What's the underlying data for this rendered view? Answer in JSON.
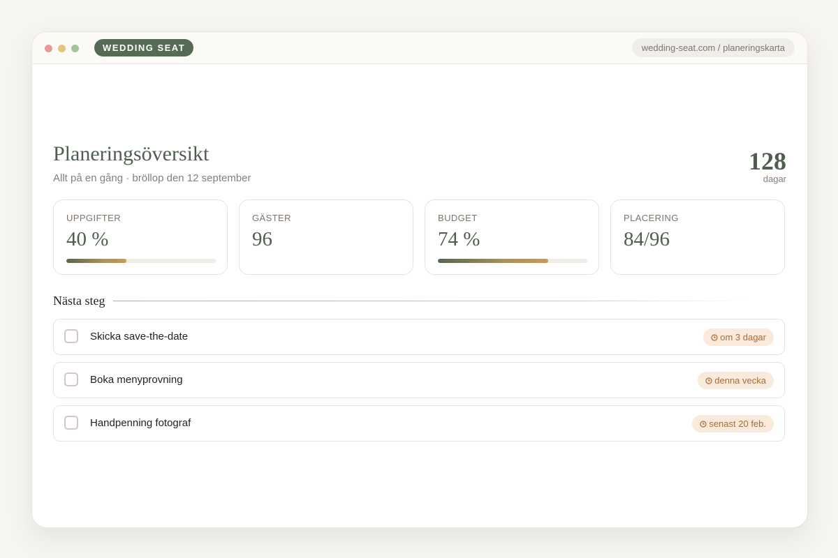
{
  "colors": {
    "brand": "#556b54",
    "dot_red": "#e8999b",
    "dot_yellow": "#e7c380",
    "dot_green": "#a5c49b",
    "accent_gold": "#c79a52",
    "badge_bg": "#f9eadb",
    "badge_text": "#a76c33"
  },
  "window": {
    "brand": "WEDDING SEAT",
    "url": "wedding-seat.com / planeringskarta"
  },
  "header": {
    "title": "Planeringsöversikt",
    "subtitle": "Allt på en gång · bröllop den 12 september",
    "countdown_value": "128",
    "countdown_unit": "dagar"
  },
  "stats": [
    {
      "label": "UPPGIFTER",
      "value": "40 %",
      "progress": 0.4
    },
    {
      "label": "GÄSTER",
      "value": "96"
    },
    {
      "label": "BUDGET",
      "value": "74 %",
      "progress": 0.74
    },
    {
      "label": "PLACERING",
      "value": "84/96"
    }
  ],
  "next_steps": {
    "title": "Nästa steg",
    "tasks": [
      {
        "label": "Skicka save-the-date",
        "due": "om 3 dagar",
        "icon": "clock-icon"
      },
      {
        "label": "Boka menyprovning",
        "due": "denna vecka",
        "icon": "clock-icon"
      },
      {
        "label": "Handpenning fotograf",
        "due": "senast 20 feb.",
        "icon": "clock-icon"
      }
    ]
  }
}
